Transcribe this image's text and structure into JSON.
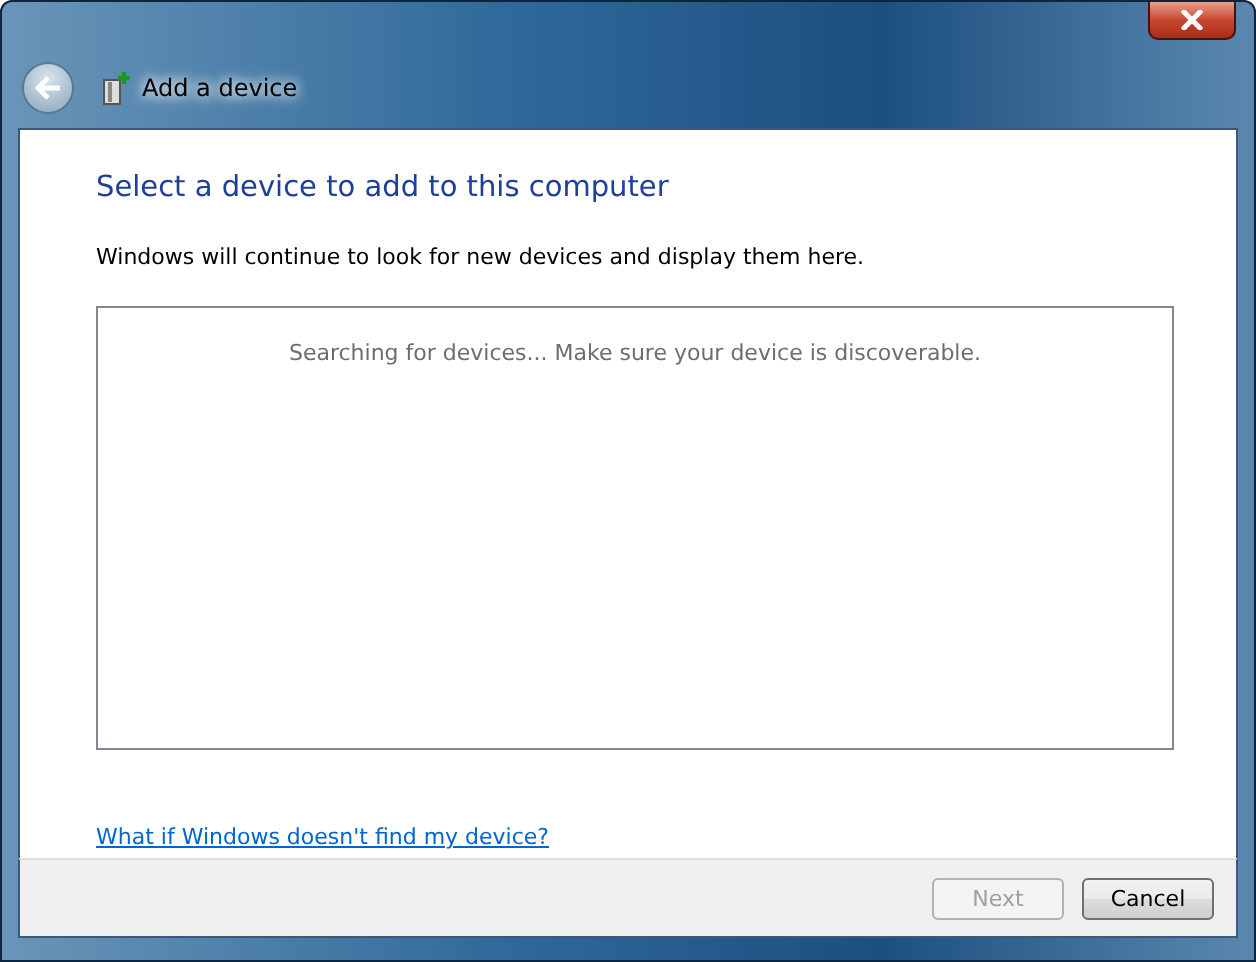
{
  "window": {
    "title": "Add a device"
  },
  "heading": "Select a device to add to this computer",
  "description": "Windows will continue to look for new devices and display them here.",
  "device_list": {
    "status": "Searching for devices...  Make sure your device is discoverable."
  },
  "help_link": "What if Windows doesn't find my device?",
  "buttons": [
    {
      "label": "Next",
      "disabled": true
    },
    {
      "label": "Cancel",
      "disabled": false
    }
  ]
}
